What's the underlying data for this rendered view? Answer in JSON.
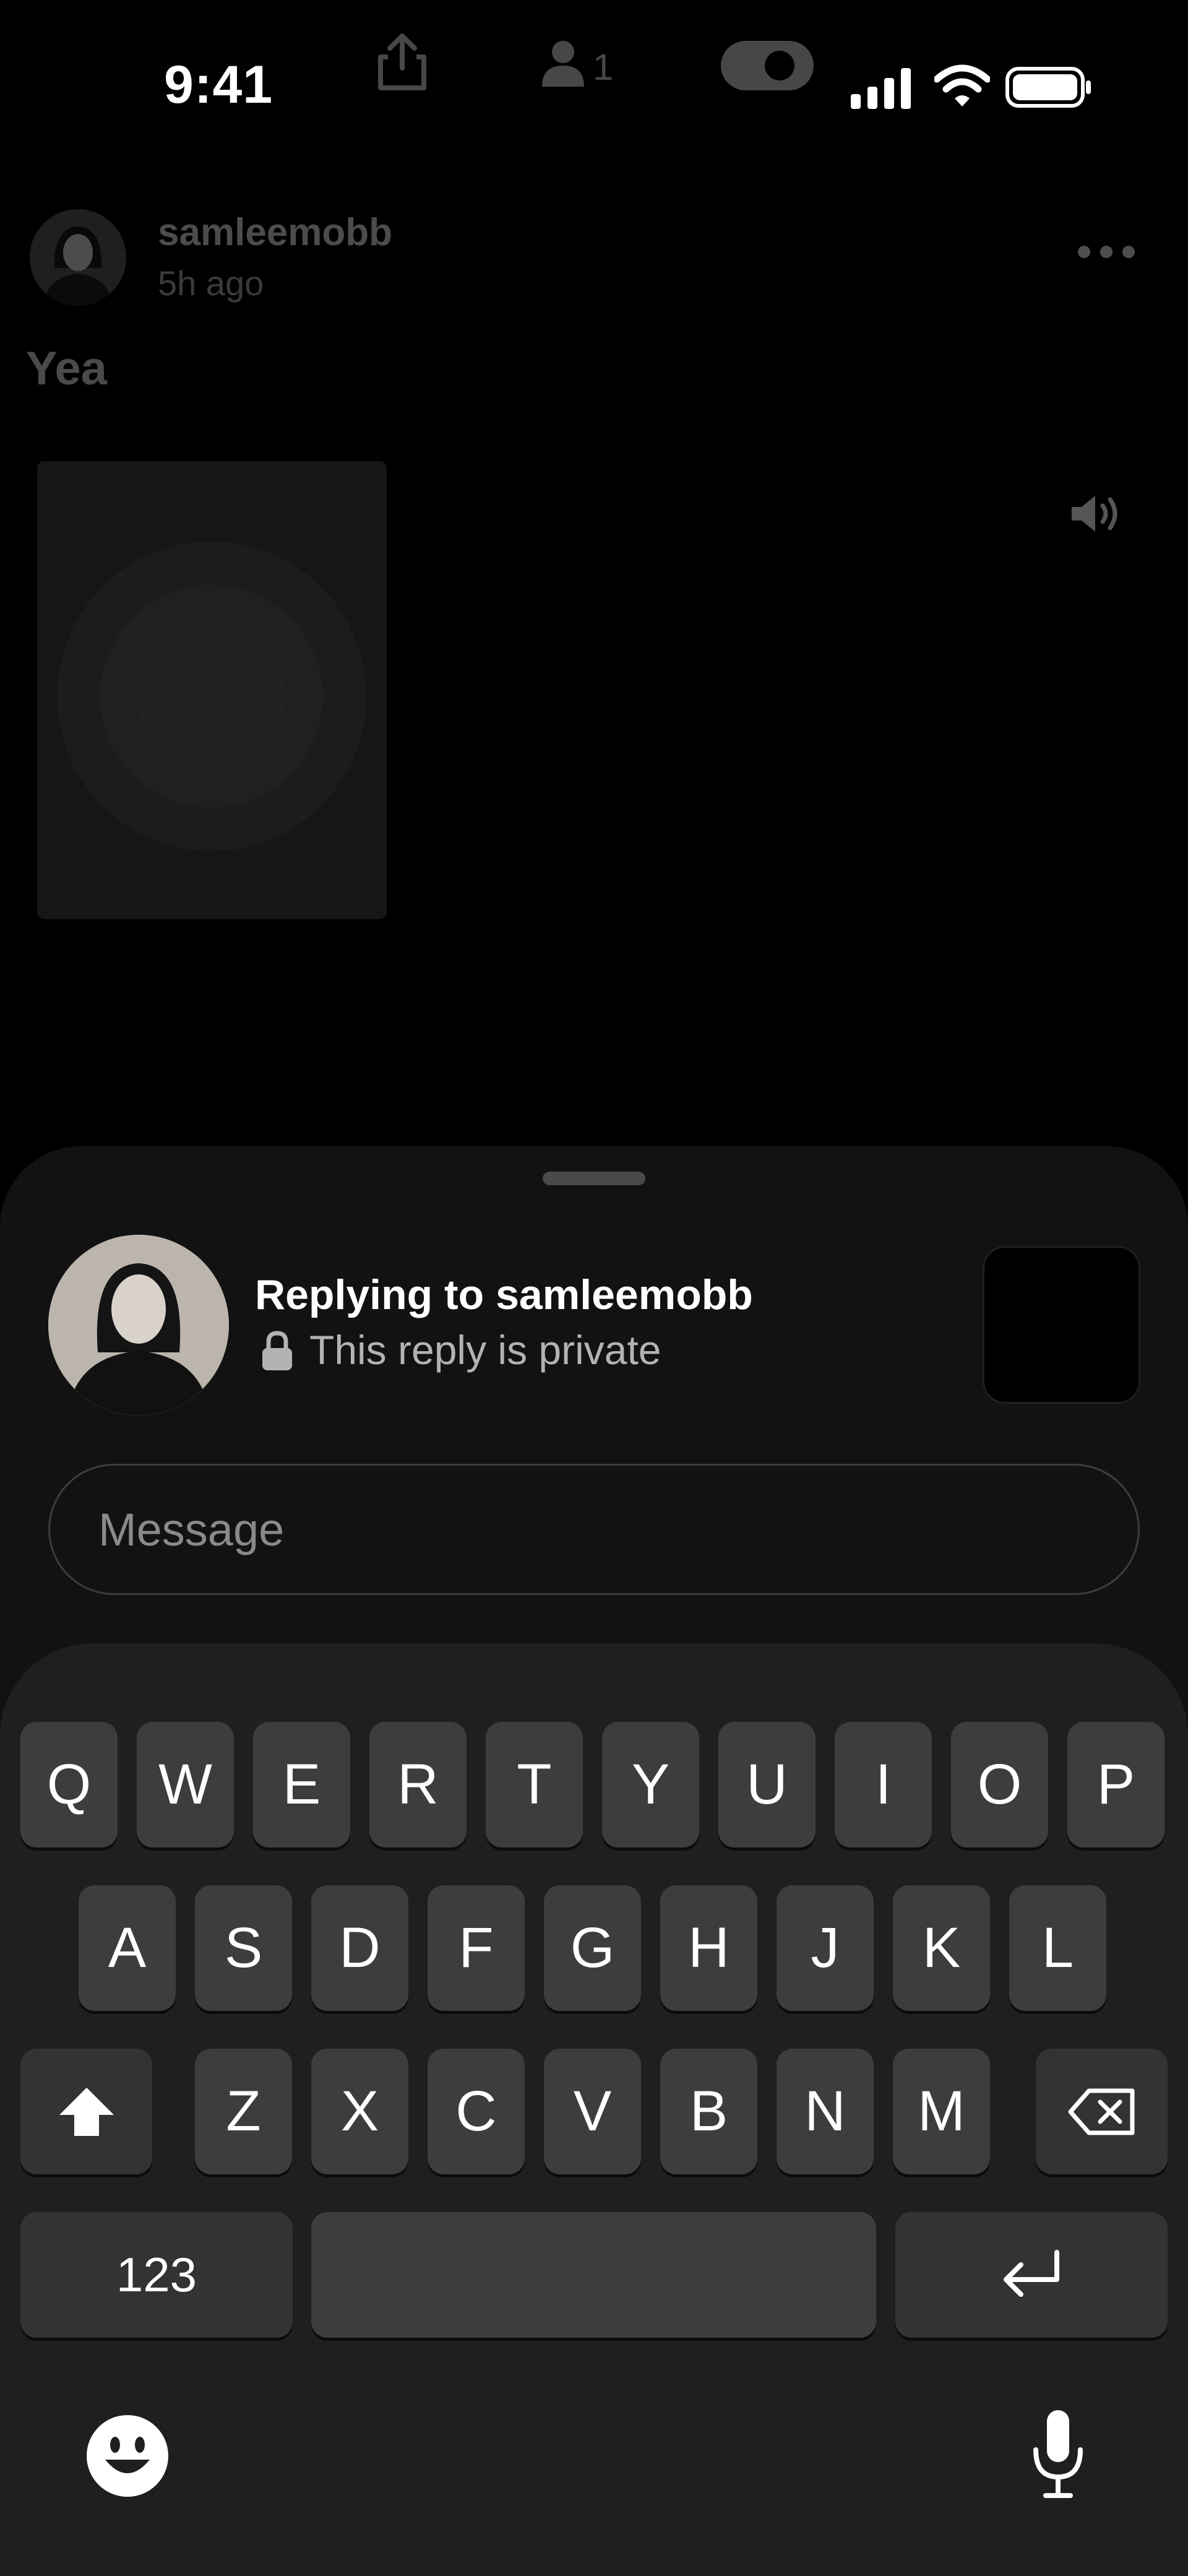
{
  "status_bar": {
    "time": "9:41",
    "viewer_count": "1",
    "icons": [
      "share-icon",
      "person-icon",
      "camera-pill-icon",
      "cellular-signal-icon",
      "wifi-icon",
      "battery-icon"
    ]
  },
  "post": {
    "username": "samleemobb",
    "time_ago": "5h ago",
    "caption": "Yea",
    "icons": [
      "more-icon",
      "volume-icon"
    ]
  },
  "reply_sheet": {
    "title": "Replying to samleemobb",
    "privacy_text": "This reply is private",
    "message_placeholder": "Message"
  },
  "keyboard": {
    "row1": [
      "Q",
      "W",
      "E",
      "R",
      "T",
      "Y",
      "U",
      "I",
      "O",
      "P"
    ],
    "row2": [
      "A",
      "S",
      "D",
      "F",
      "G",
      "H",
      "J",
      "K",
      "L"
    ],
    "row3": [
      "Z",
      "X",
      "C",
      "V",
      "B",
      "N",
      "M"
    ],
    "numbers_label": "123",
    "icons": [
      "shift-icon",
      "delete-icon",
      "return-icon",
      "emoji-icon",
      "microphone-icon"
    ]
  },
  "colors": {
    "background": "#000000",
    "sheet": "#121212",
    "keyboard": "#1F1F1F",
    "key": "#3D3D3D"
  }
}
